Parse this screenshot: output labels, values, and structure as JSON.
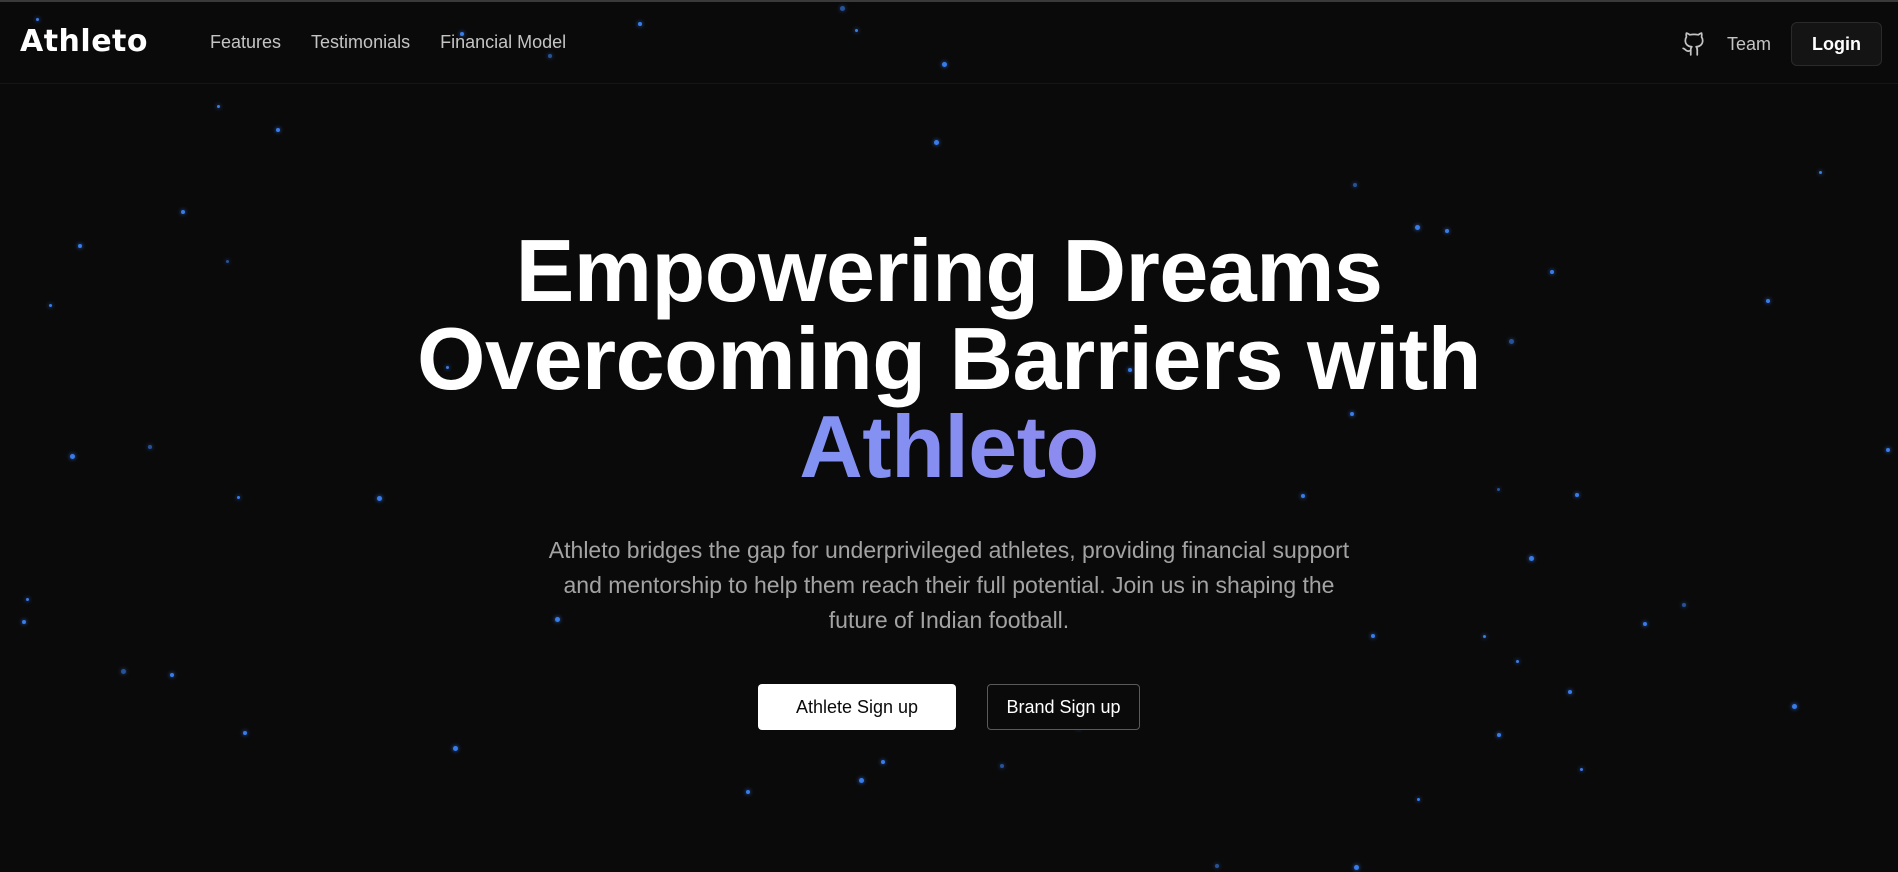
{
  "navbar": {
    "logo": "Athleto",
    "links": [
      {
        "label": "Features"
      },
      {
        "label": "Testimonials"
      },
      {
        "label": "Financial Model"
      }
    ],
    "github_icon": "github-icon",
    "team_label": "Team",
    "login_label": "Login"
  },
  "hero": {
    "title_line1": "Empowering Dreams",
    "title_line2": "Overcoming Barriers with",
    "title_brand": "Athleto",
    "subtitle": "Athleto bridges the gap for underprivileged athletes, providing financial support and mentorship to help them reach their full potential. Join us in shaping the future of Indian football.",
    "primary_cta": "Athlete Sign up",
    "secondary_cta": "Brand Sign up"
  },
  "colors": {
    "background": "#0a0a0a",
    "star": "#3b82f6",
    "gradient_start": "#60a5fa",
    "gradient_end": "#c084fc",
    "muted_text": "#a3a3a3"
  }
}
